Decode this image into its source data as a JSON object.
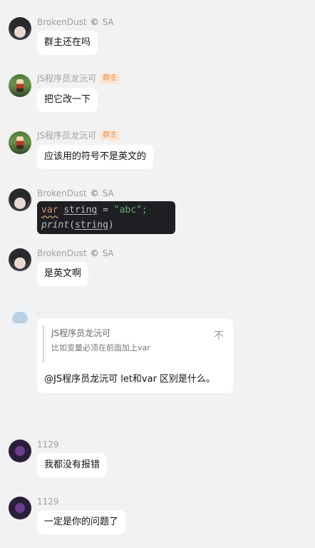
{
  "messages": [
    {
      "sender": "BrokenDust",
      "title_icon": "©",
      "title": "SA",
      "text": "群主还在吗"
    },
    {
      "sender": "JS程序员龙沅可",
      "badge": "群主",
      "text": "把它改一下"
    },
    {
      "sender": "JS程序员龙沅可",
      "badge": "群主",
      "text": "应该用的符号不是英文的"
    },
    {
      "sender": "BrokenDust",
      "title_icon": "©",
      "title": "SA",
      "code": {
        "line1": {
          "kw": "var",
          "ident": "string",
          "op": " = ",
          "str": "\"abc\"",
          "end": ";"
        },
        "line2": {
          "fn": "print",
          "open": "(",
          "ident": "string",
          "close": ")"
        }
      }
    },
    {
      "sender": "BrokenDust",
      "title_icon": "©",
      "title": "SA",
      "text": "是英文啊"
    },
    {
      "sender": ".",
      "quote": {
        "name": "JS程序员龙沅可",
        "text": "比如变量必须在前面加上var",
        "jump_icon": "不"
      },
      "text": "@JS程序员龙沅可 let和var 区别是什么。"
    },
    {
      "sender": "1129",
      "text": "我都没有报错"
    },
    {
      "sender": "1129",
      "text": "一定是你的问题了"
    }
  ]
}
